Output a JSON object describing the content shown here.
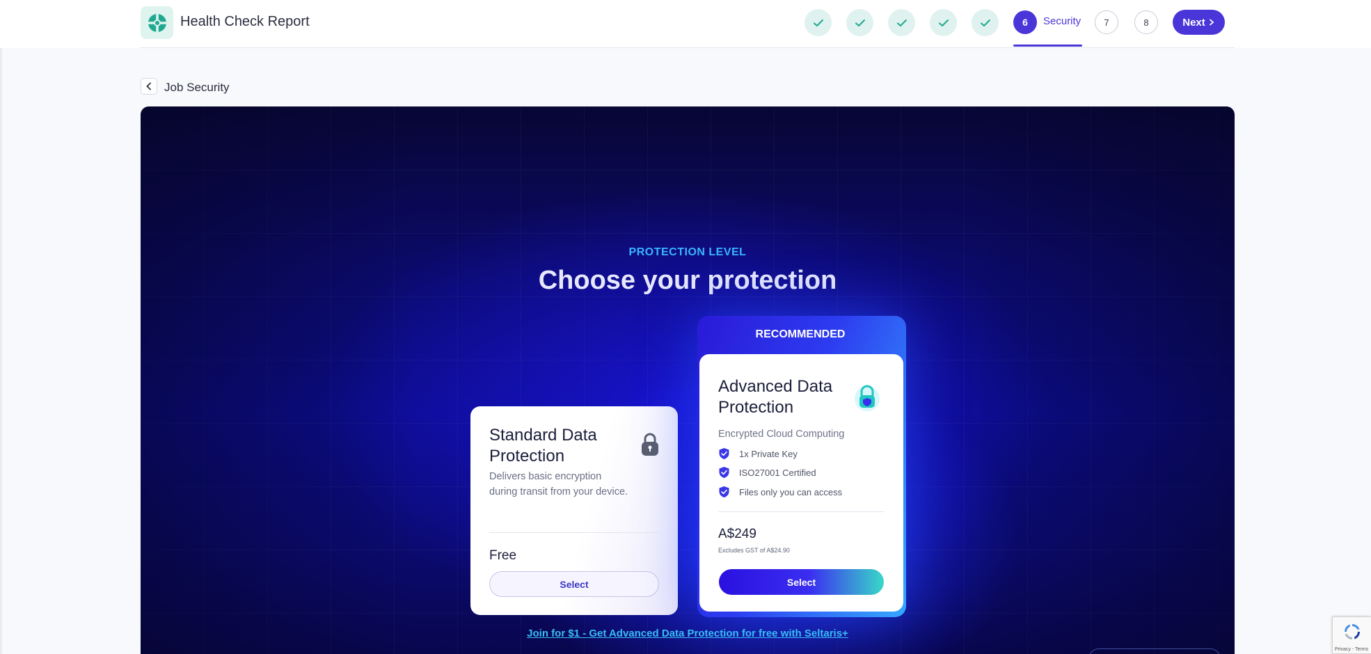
{
  "app": {
    "title": "Health Check Report"
  },
  "stepper": {
    "completed_count": 5,
    "active": {
      "number": "6",
      "label": "Security"
    },
    "future": [
      "7",
      "8"
    ],
    "next_label": "Next"
  },
  "breadcrumb": {
    "back_label": "Job Security"
  },
  "hero": {
    "eyebrow": "PROTECTION LEVEL",
    "headline": "Choose your protection",
    "join_link": "Join for $1 - Get Advanced Data Protection for free with Seltaris+"
  },
  "standard": {
    "title_line1": "Standard Data",
    "title_line2": "Protection",
    "desc_line1": "Delivers basic encryption",
    "desc_line2": "during transit from your device.",
    "price": "Free",
    "select_label": "Select"
  },
  "advanced": {
    "badge": "RECOMMENDED",
    "title_line1": "Advanced Data",
    "title_line2": "Protection",
    "subtitle": "Encrypted Cloud Computing",
    "features": [
      "1x Private Key",
      "ISO27001 Certified",
      "Files only you can access"
    ],
    "price": "A$249",
    "price_note": "Excludes GST of A$24.90",
    "select_label": "Select"
  },
  "recaptcha": {
    "text": "Privacy - Terms"
  },
  "colors": {
    "accent": "#4a36d8",
    "teal": "#1fa98f",
    "link": "#38bdf8"
  }
}
